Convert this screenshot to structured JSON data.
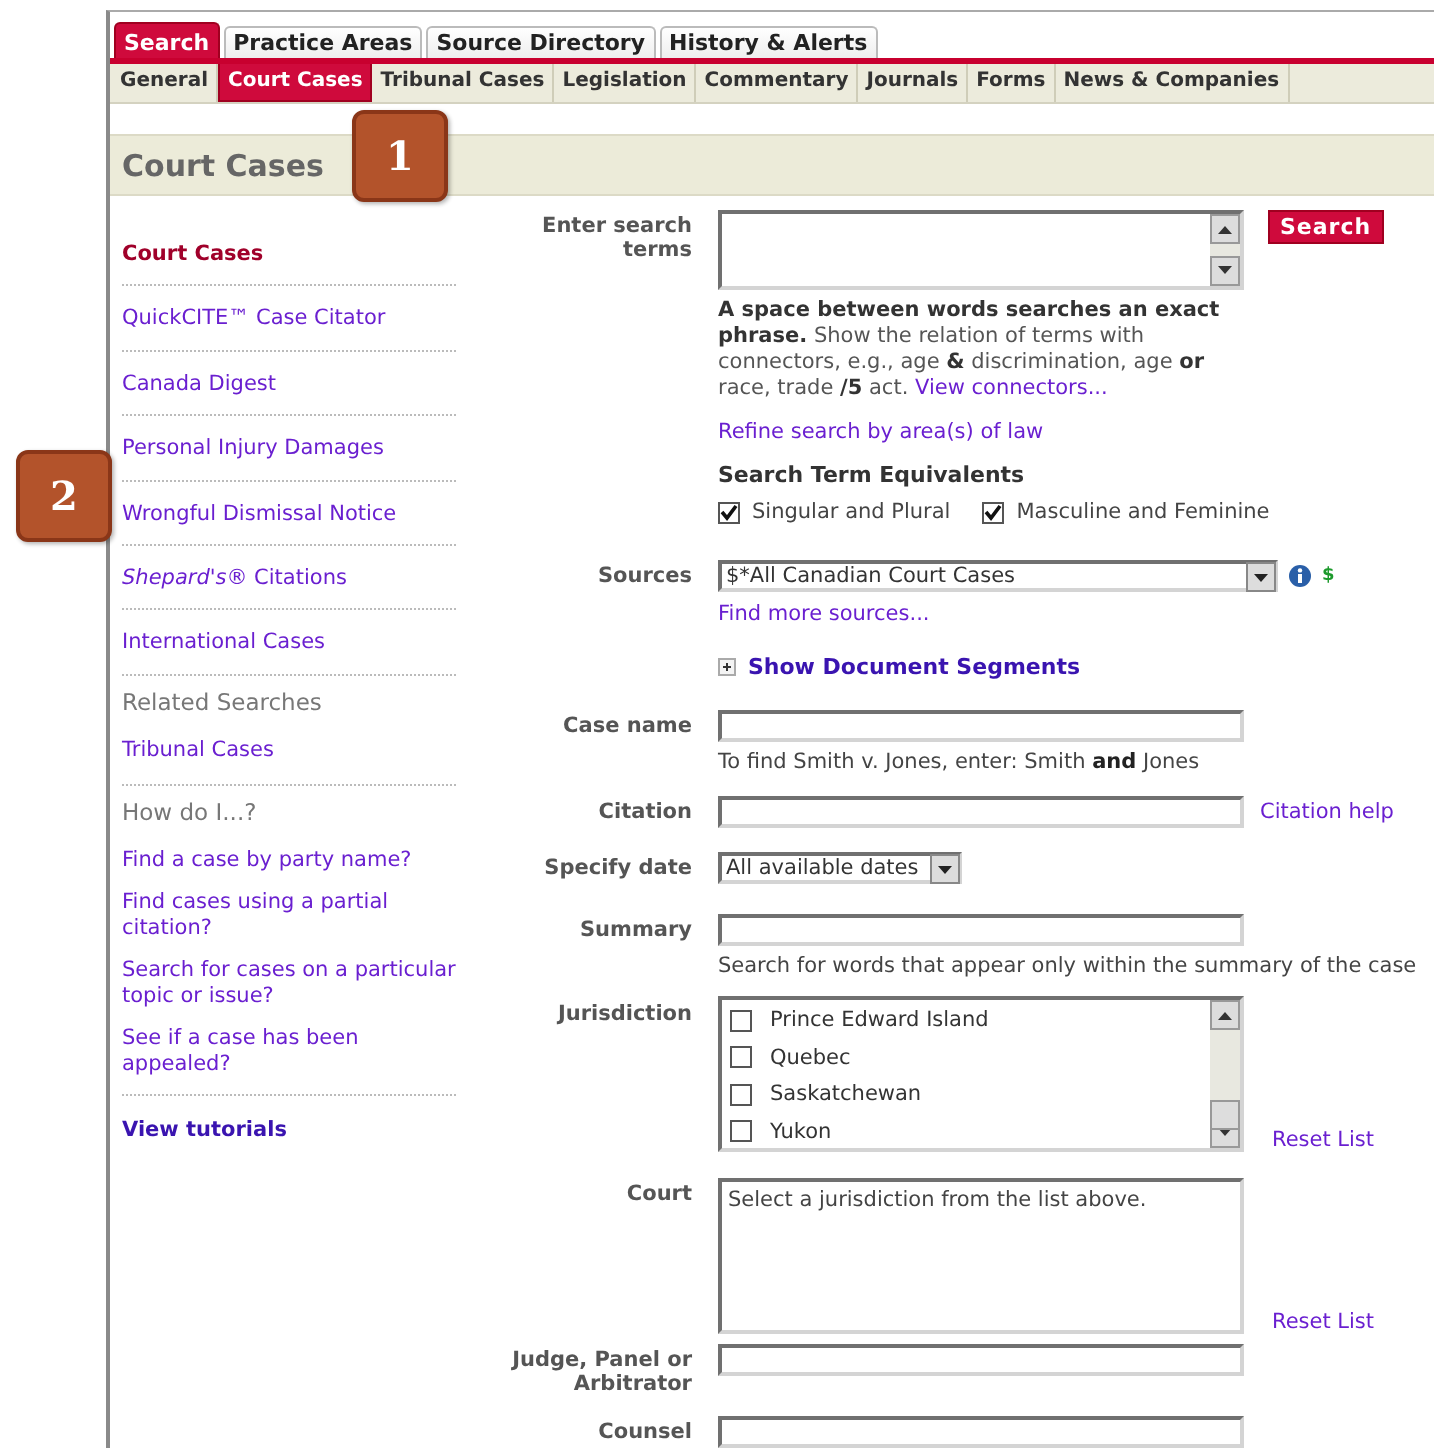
{
  "main_tabs": [
    {
      "label": "Search",
      "selected": true
    },
    {
      "label": "Practice Areas",
      "selected": false
    },
    {
      "label": "Source Directory",
      "selected": false
    },
    {
      "label": "History & Alerts",
      "selected": false
    }
  ],
  "sub_tabs": [
    {
      "label": "General",
      "selected": false
    },
    {
      "label": "Court Cases",
      "selected": true
    },
    {
      "label": "Tribunal Cases",
      "selected": false
    },
    {
      "label": "Legislation",
      "selected": false
    },
    {
      "label": "Commentary",
      "selected": false
    },
    {
      "label": "Journals",
      "selected": false
    },
    {
      "label": "Forms",
      "selected": false
    },
    {
      "label": "News & Companies",
      "selected": false
    }
  ],
  "page_title": "Court Cases",
  "callouts": [
    {
      "label": "1"
    },
    {
      "label": "2"
    }
  ],
  "sidebar": {
    "links": [
      {
        "label": "Court Cases",
        "selected": true
      },
      {
        "label": "QuickCITE™ Case Citator",
        "selected": false
      },
      {
        "label": "Canada Digest",
        "selected": false
      },
      {
        "label": "Personal Injury Damages",
        "selected": false
      },
      {
        "label": "Wrongful Dismissal Notice",
        "selected": false
      },
      {
        "label": "*Shepard's*® Citations",
        "selected": false
      },
      {
        "label": "International Cases",
        "selected": false
      }
    ],
    "related_heading": "Related Searches",
    "related_links": [
      "Tribunal Cases"
    ],
    "howto_heading": "How do I...?",
    "howto_links": [
      "Find a case by party name?",
      "Find cases using a partial citation?",
      "Search for cases on a particular topic or issue?",
      "See if a case has been appealed?"
    ],
    "tutorials_link": "View tutorials"
  },
  "form": [
    {
      "kind": "search_terms",
      "label": "Enter search terms",
      "button": "Search",
      "help": "**A space between words searches an exact phrase.** Show the relation of terms with connectors, e.g., age **&** discrimination, age **or** race, trade **/5** act.",
      "help_link": "View connectors...",
      "refine_link": "Refine search by area(s) of law",
      "equivalents_heading": "Search Term Equivalents",
      "equivalents": [
        {
          "label": "Singular and Plural",
          "checked": true
        },
        {
          "label": "Masculine and Feminine",
          "checked": true
        }
      ]
    },
    {
      "kind": "wide_select",
      "label": "Sources",
      "value": "$*All Canadian Court Cases",
      "cost": "$",
      "link": "Find more sources..."
    },
    {
      "kind": "segments",
      "label": "Show Document Segments",
      "expanded": false
    },
    {
      "kind": "text",
      "label": "Case name",
      "hint": "To find Smith v. Jones, enter: Smith **and** Jones"
    },
    {
      "kind": "text",
      "label": "Citation",
      "link": "Citation help"
    },
    {
      "kind": "select",
      "label": "Specify date",
      "value": "All available dates"
    },
    {
      "kind": "text",
      "label": "Summary",
      "hint": "Search for words that appear only within the summary of the case"
    },
    {
      "kind": "checklist",
      "label": "Jurisdiction",
      "items": [
        {
          "label": "Prince Edward Island",
          "checked": false
        },
        {
          "label": "Quebec",
          "checked": false
        },
        {
          "label": "Saskatchewan",
          "checked": false
        },
        {
          "label": "Yukon",
          "checked": false
        }
      ],
      "link": "Reset List"
    },
    {
      "kind": "textarea",
      "label": "Court",
      "value": "Select a jurisdiction from the list above.",
      "link": "Reset List"
    },
    {
      "kind": "text",
      "label": "Judge, Panel or Arbitrator"
    },
    {
      "kind": "text",
      "label": "Counsel"
    }
  ]
}
